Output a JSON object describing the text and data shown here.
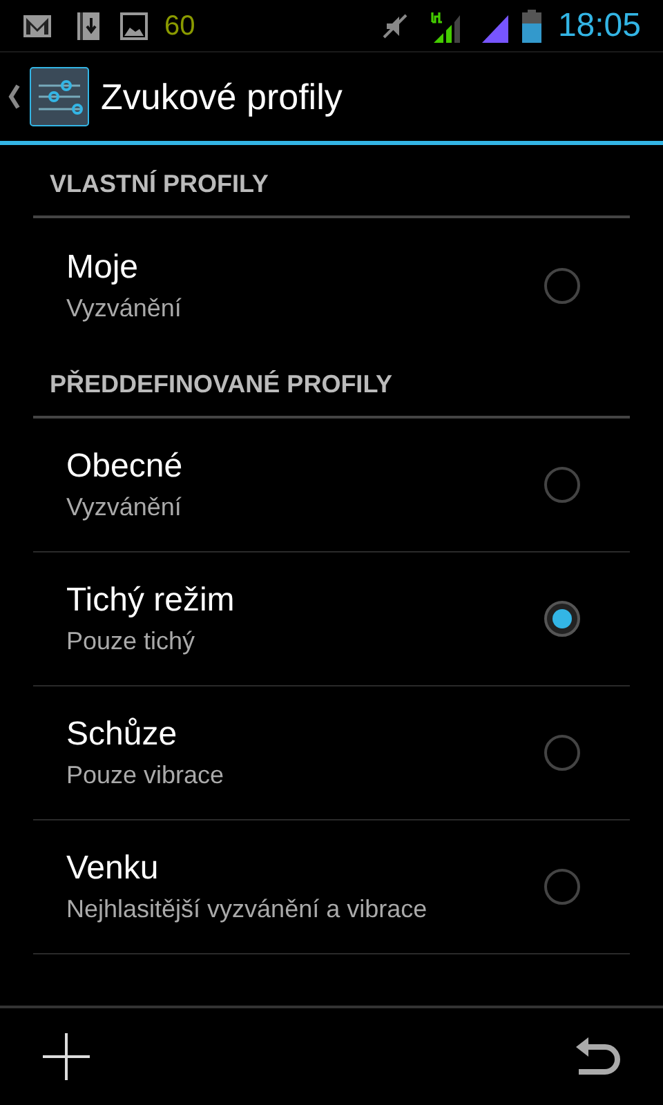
{
  "status_bar": {
    "notification_count": "60",
    "time": "18:05"
  },
  "action_bar": {
    "title": "Zvukové profily"
  },
  "sections": [
    {
      "header": "VLASTNÍ PROFILY",
      "items": [
        {
          "title": "Moje",
          "subtitle": "Vyzvánění",
          "selected": false
        }
      ]
    },
    {
      "header": "PŘEDDEFINOVANÉ PROFILY",
      "items": [
        {
          "title": "Obecné",
          "subtitle": "Vyzvánění",
          "selected": false
        },
        {
          "title": "Tichý režim",
          "subtitle": "Pouze tichý",
          "selected": true
        },
        {
          "title": "Schůze",
          "subtitle": "Pouze vibrace",
          "selected": false
        },
        {
          "title": "Venku",
          "subtitle": "Nejhlasitější vyzvánění a vibrace",
          "selected": false
        }
      ]
    }
  ]
}
